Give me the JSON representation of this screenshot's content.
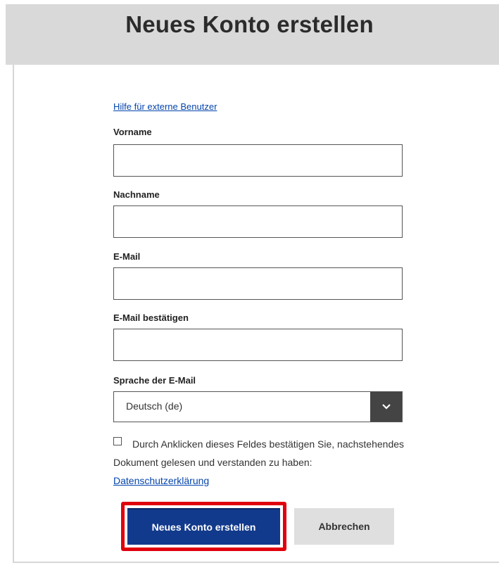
{
  "header": {
    "title": "Neues Konto erstellen"
  },
  "form": {
    "help_link": "Hilfe für externe Benutzer",
    "fields": [
      {
        "label": "Vorname",
        "value": ""
      },
      {
        "label": "Nachname",
        "value": ""
      },
      {
        "label": "E-Mail",
        "value": ""
      },
      {
        "label": "E-Mail bestätigen",
        "value": ""
      }
    ],
    "language": {
      "label": "Sprache der E-Mail",
      "selected": "Deutsch (de)",
      "icon": "chevron-down-icon"
    },
    "consent": {
      "checked": false,
      "text": "Durch Anklicken dieses Feldes bestätigen Sie, nachstehendes Dokument gelesen und verstanden zu haben: ",
      "link": "Datenschutzerklärung"
    },
    "actions": {
      "submit_label": "Neues Konto erstellen",
      "cancel_label": "Abbrechen"
    }
  },
  "colors": {
    "header_band": "#d9d9d9",
    "primary": "#123a8c",
    "highlight": "#e0000d",
    "link": "#0645ad"
  }
}
